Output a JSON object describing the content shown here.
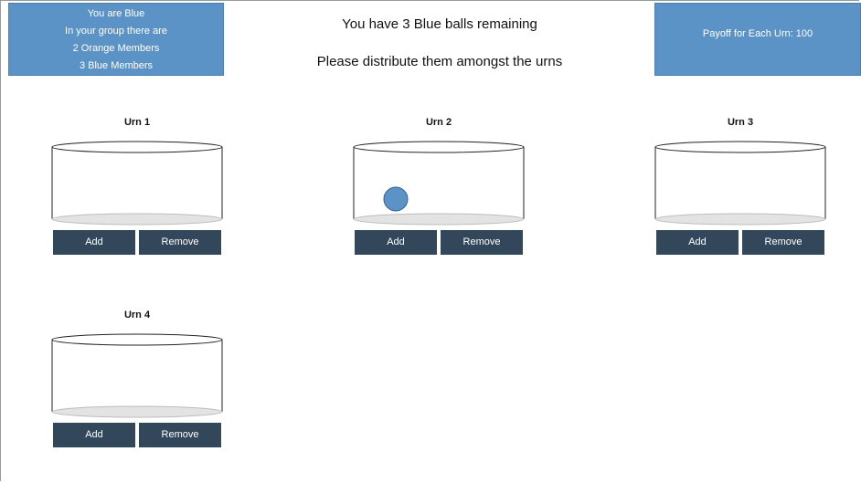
{
  "info": {
    "line1": "You are Blue",
    "line2": "In your group there are",
    "line3": "2 Orange Members",
    "line4": "3 Blue Members"
  },
  "header": {
    "remaining": "You have 3 Blue balls remaining",
    "instruction": "Please distribute them amongst the urns"
  },
  "payoff": {
    "label": "Payoff for Each Urn: 100"
  },
  "colors": {
    "panel": "#5b93c7",
    "button": "#33475b",
    "ball_blue": "#5b93c7"
  },
  "urns": [
    {
      "title": "Urn 1",
      "balls": 0,
      "add_label": "Add",
      "remove_label": "Remove"
    },
    {
      "title": "Urn 2",
      "balls": 1,
      "add_label": "Add",
      "remove_label": "Remove"
    },
    {
      "title": "Urn 3",
      "balls": 0,
      "add_label": "Add",
      "remove_label": "Remove"
    },
    {
      "title": "Urn 4",
      "balls": 0,
      "add_label": "Add",
      "remove_label": "Remove"
    }
  ]
}
